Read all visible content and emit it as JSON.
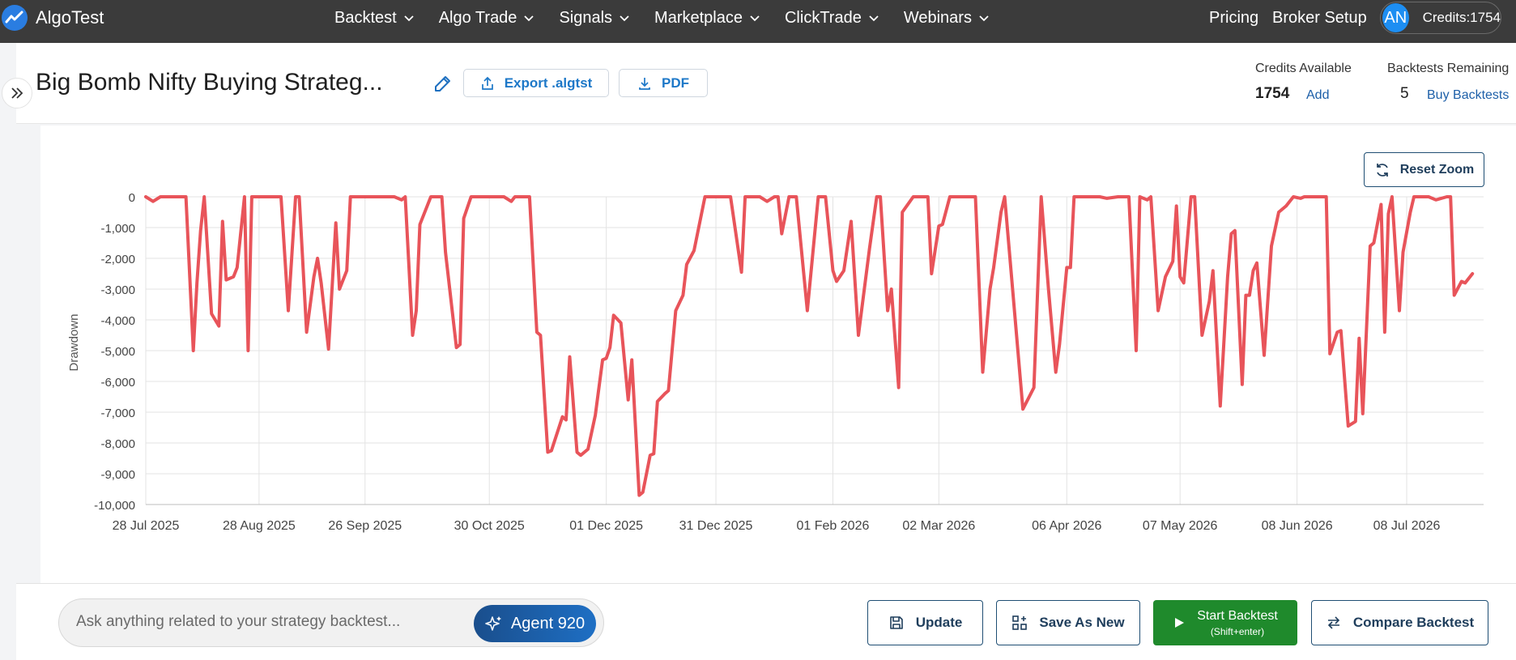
{
  "nav": {
    "logo_text": "AlgoTest",
    "menu": [
      "Backtest",
      "Algo Trade",
      "Signals",
      "Marketplace",
      "ClickTrade",
      "Webinars"
    ],
    "pricing": "Pricing",
    "broker_setup": "Broker Setup",
    "avatar_initials": "AN",
    "credits_label": "Credits:1754"
  },
  "header": {
    "title": "Big Bomb Nifty Buying Strateg...",
    "export_label": "Export .algtst",
    "pdf_label": "PDF",
    "credits_available_label": "Credits Available",
    "credits_available_value": "1754",
    "add_label": "Add",
    "backtests_remaining_label": "Backtests Remaining",
    "backtests_remaining_value": "5",
    "buy_backtests_label": "Buy Backtests"
  },
  "chart_controls": {
    "reset_zoom_label": "Reset Zoom"
  },
  "chart_data": {
    "type": "line",
    "ylabel": "Drawdown",
    "xlabel": "",
    "ylim": [
      -10000,
      0
    ],
    "y_ticks": [
      "0",
      "-1,000",
      "-2,000",
      "-3,000",
      "-4,000",
      "-5,000",
      "-6,000",
      "-7,000",
      "-8,000",
      "-9,000",
      "-10,000"
    ],
    "x_ticks": [
      "28 Jul 2025",
      "28 Aug 2025",
      "26 Sep 2025",
      "30 Oct 2025",
      "01 Dec 2025",
      "31 Dec 2025",
      "01 Feb 2026",
      "02 Mar 2026",
      "06 Apr 2026",
      "07 May 2026",
      "08 Jun 2026",
      "08 Jul 2026"
    ],
    "x_tick_dates": [
      "2025-07-28",
      "2025-08-28",
      "2025-09-26",
      "2025-10-30",
      "2025-12-01",
      "2025-12-31",
      "2026-02-01",
      "2026-03-02",
      "2026-04-06",
      "2026-05-07",
      "2026-06-08",
      "2026-07-08"
    ],
    "grid": true,
    "line_color": "#e8545a",
    "series": [
      {
        "points": [
          [
            "2025-07-28",
            0
          ],
          [
            "2025-07-30",
            -150
          ],
          [
            "2025-08-01",
            0
          ],
          [
            "2025-08-04",
            0
          ],
          [
            "2025-08-08",
            0
          ],
          [
            "2025-08-10",
            -5000
          ],
          [
            "2025-08-11",
            -2800
          ],
          [
            "2025-08-12",
            -1100
          ],
          [
            "2025-08-13",
            0
          ],
          [
            "2025-08-15",
            -3800
          ],
          [
            "2025-08-17",
            -4200
          ],
          [
            "2025-08-18",
            -800
          ],
          [
            "2025-08-19",
            -2700
          ],
          [
            "2025-08-21",
            -2600
          ],
          [
            "2025-08-22",
            -2300
          ],
          [
            "2025-08-24",
            0
          ],
          [
            "2025-08-25",
            -5000
          ],
          [
            "2025-08-26",
            0
          ],
          [
            "2025-08-28",
            0
          ],
          [
            "2025-09-03",
            0
          ],
          [
            "2025-09-05",
            -3700
          ],
          [
            "2025-09-07",
            0
          ],
          [
            "2025-09-08",
            0
          ],
          [
            "2025-09-10",
            -4400
          ],
          [
            "2025-09-12",
            -2600
          ],
          [
            "2025-09-13",
            -2000
          ],
          [
            "2025-09-14",
            -2800
          ],
          [
            "2025-09-16",
            -4950
          ],
          [
            "2025-09-18",
            -850
          ],
          [
            "2025-09-19",
            -3000
          ],
          [
            "2025-09-21",
            -2400
          ],
          [
            "2025-09-22",
            0
          ],
          [
            "2025-10-04",
            0
          ],
          [
            "2025-10-06",
            -100
          ],
          [
            "2025-10-07",
            0
          ],
          [
            "2025-10-09",
            -4500
          ],
          [
            "2025-10-10",
            -3700
          ],
          [
            "2025-10-11",
            -900
          ],
          [
            "2025-10-14",
            0
          ],
          [
            "2025-10-17",
            0
          ],
          [
            "2025-10-18",
            -1800
          ],
          [
            "2025-10-21",
            -4900
          ],
          [
            "2025-10-22",
            -4800
          ],
          [
            "2025-10-23",
            -700
          ],
          [
            "2025-10-25",
            0
          ],
          [
            "2025-11-03",
            0
          ],
          [
            "2025-11-05",
            -150
          ],
          [
            "2025-11-06",
            0
          ],
          [
            "2025-11-10",
            0
          ],
          [
            "2025-11-12",
            -4400
          ],
          [
            "2025-11-13",
            -4500
          ],
          [
            "2025-11-15",
            -8300
          ],
          [
            "2025-11-16",
            -8250
          ],
          [
            "2025-11-19",
            -7150
          ],
          [
            "2025-11-20",
            -7250
          ],
          [
            "2025-11-21",
            -5200
          ],
          [
            "2025-11-23",
            -8300
          ],
          [
            "2025-11-24",
            -8400
          ],
          [
            "2025-11-26",
            -8200
          ],
          [
            "2025-11-28",
            -7100
          ],
          [
            "2025-11-30",
            -5300
          ],
          [
            "2025-12-01",
            -5250
          ],
          [
            "2025-12-02",
            -4900
          ],
          [
            "2025-12-03",
            -3850
          ],
          [
            "2025-12-05",
            -4100
          ],
          [
            "2025-12-07",
            -6600
          ],
          [
            "2025-12-08",
            -5300
          ],
          [
            "2025-12-10",
            -9700
          ],
          [
            "2025-12-11",
            -9600
          ],
          [
            "2025-12-13",
            -8400
          ],
          [
            "2025-12-14",
            -8350
          ],
          [
            "2025-12-15",
            -6650
          ],
          [
            "2025-12-17",
            -6400
          ],
          [
            "2025-12-18",
            -6300
          ],
          [
            "2025-12-20",
            -3700
          ],
          [
            "2025-12-22",
            -3200
          ],
          [
            "2025-12-23",
            -2200
          ],
          [
            "2025-12-25",
            -1750
          ],
          [
            "2025-12-28",
            0
          ],
          [
            "2026-01-04",
            0
          ],
          [
            "2026-01-07",
            -2450
          ],
          [
            "2026-01-08",
            0
          ],
          [
            "2026-01-12",
            0
          ],
          [
            "2026-01-14",
            -150
          ],
          [
            "2026-01-16",
            0
          ],
          [
            "2026-01-17",
            0
          ],
          [
            "2026-01-18",
            -1200
          ],
          [
            "2026-01-20",
            0
          ],
          [
            "2026-01-22",
            0
          ],
          [
            "2026-01-25",
            -3700
          ],
          [
            "2026-01-28",
            0
          ],
          [
            "2026-01-30",
            0
          ],
          [
            "2026-02-01",
            -2400
          ],
          [
            "2026-02-02",
            -2750
          ],
          [
            "2026-02-04",
            -2400
          ],
          [
            "2026-02-06",
            -800
          ],
          [
            "2026-02-08",
            -4500
          ],
          [
            "2026-02-11",
            -1700
          ],
          [
            "2026-02-13",
            0
          ],
          [
            "2026-02-14",
            0
          ],
          [
            "2026-02-16",
            -3700
          ],
          [
            "2026-02-17",
            -3000
          ],
          [
            "2026-02-19",
            -6200
          ],
          [
            "2026-02-20",
            -500
          ],
          [
            "2026-02-23",
            0
          ],
          [
            "2026-02-27",
            0
          ],
          [
            "2026-02-28",
            -2500
          ],
          [
            "2026-03-02",
            -950
          ],
          [
            "2026-03-03",
            -900
          ],
          [
            "2026-03-05",
            0
          ],
          [
            "2026-03-12",
            0
          ],
          [
            "2026-03-14",
            -5700
          ],
          [
            "2026-03-16",
            -3000
          ],
          [
            "2026-03-17",
            -2300
          ],
          [
            "2026-03-19",
            -500
          ],
          [
            "2026-03-20",
            0
          ],
          [
            "2026-03-25",
            -6900
          ],
          [
            "2026-03-28",
            -6200
          ],
          [
            "2026-03-30",
            0
          ],
          [
            "2026-04-01",
            -3000
          ],
          [
            "2026-04-03",
            -5700
          ],
          [
            "2026-04-04",
            -4800
          ],
          [
            "2026-04-06",
            -2300
          ],
          [
            "2026-04-07",
            -2300
          ],
          [
            "2026-04-08",
            0
          ],
          [
            "2026-04-15",
            0
          ],
          [
            "2026-04-17",
            -50
          ],
          [
            "2026-04-20",
            0
          ],
          [
            "2026-04-23",
            0
          ],
          [
            "2026-04-25",
            -5000
          ],
          [
            "2026-04-26",
            0
          ],
          [
            "2026-04-28",
            -100
          ],
          [
            "2026-04-29",
            0
          ],
          [
            "2026-05-01",
            -3700
          ],
          [
            "2026-05-03",
            -2600
          ],
          [
            "2026-05-05",
            -2100
          ],
          [
            "2026-05-06",
            -300
          ],
          [
            "2026-05-07",
            -2600
          ],
          [
            "2026-05-08",
            -2800
          ],
          [
            "2026-05-10",
            0
          ],
          [
            "2026-05-11",
            0
          ],
          [
            "2026-05-13",
            -4500
          ],
          [
            "2026-05-15",
            -3400
          ],
          [
            "2026-05-16",
            -2400
          ],
          [
            "2026-05-18",
            -6800
          ],
          [
            "2026-05-20",
            -2600
          ],
          [
            "2026-05-21",
            -1200
          ],
          [
            "2026-05-22",
            -1100
          ],
          [
            "2026-05-24",
            -6100
          ],
          [
            "2026-05-25",
            -3200
          ],
          [
            "2026-05-26",
            -3200
          ],
          [
            "2026-05-27",
            -2400
          ],
          [
            "2026-05-28",
            -2150
          ],
          [
            "2026-05-30",
            -5150
          ],
          [
            "2026-06-01",
            -1600
          ],
          [
            "2026-06-03",
            -500
          ],
          [
            "2026-06-05",
            -300
          ],
          [
            "2026-06-07",
            0
          ],
          [
            "2026-06-09",
            -50
          ],
          [
            "2026-06-10",
            0
          ],
          [
            "2026-06-16",
            0
          ],
          [
            "2026-06-17",
            -5100
          ],
          [
            "2026-06-19",
            -4400
          ],
          [
            "2026-06-20",
            -4350
          ],
          [
            "2026-06-22",
            -7450
          ],
          [
            "2026-06-24",
            -7300
          ],
          [
            "2026-06-25",
            -4600
          ],
          [
            "2026-06-26",
            -7050
          ],
          [
            "2026-06-28",
            -1600
          ],
          [
            "2026-06-29",
            -1500
          ],
          [
            "2026-07-01",
            -250
          ],
          [
            "2026-07-02",
            -4400
          ],
          [
            "2026-07-03",
            -550
          ],
          [
            "2026-07-04",
            0
          ],
          [
            "2026-07-06",
            -3700
          ],
          [
            "2026-07-07",
            -1800
          ],
          [
            "2026-07-09",
            -500
          ],
          [
            "2026-07-10",
            0
          ],
          [
            "2026-07-14",
            0
          ],
          [
            "2026-07-16",
            -100
          ],
          [
            "2026-07-19",
            0
          ],
          [
            "2026-07-20",
            0
          ],
          [
            "2026-07-21",
            -3200
          ],
          [
            "2026-07-23",
            -2750
          ],
          [
            "2026-07-24",
            -2800
          ],
          [
            "2026-07-26",
            -2500
          ]
        ]
      }
    ]
  },
  "assistant": {
    "placeholder": "Ask anything related to your strategy backtest...",
    "agent_label": "Agent 920"
  },
  "actions": {
    "update": "Update",
    "save_as_new": "Save As New",
    "start_backtest": "Start Backtest",
    "start_hint": "(Shift+enter)",
    "compare_backtest": "Compare Backtest"
  }
}
